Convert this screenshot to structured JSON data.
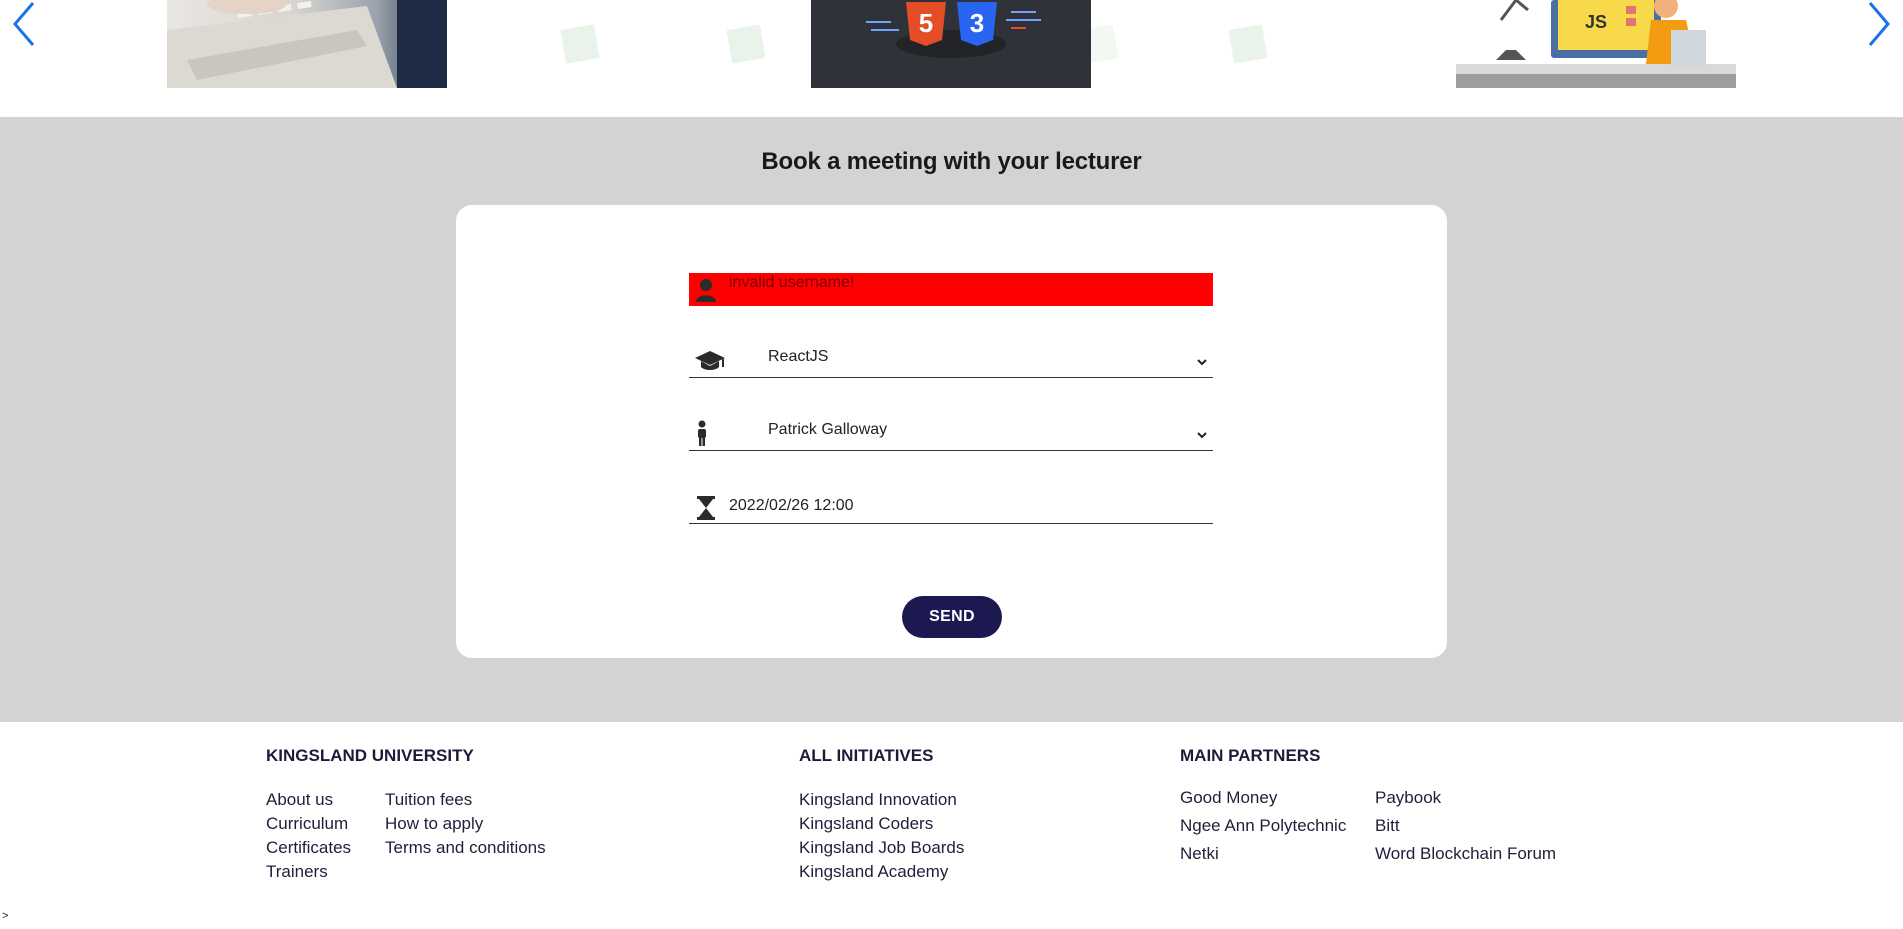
{
  "carousel": {
    "prev_icon": "chevron-left-icon",
    "next_icon": "chevron-right-icon",
    "slides": [
      {
        "name": "laptop-keyboard-photo"
      },
      {
        "name": "html5-css3-logos-image",
        "badge_html": "5",
        "badge_css": "3"
      },
      {
        "name": "javascript-developer-illustration",
        "badge_js": "JS"
      }
    ],
    "accent_color": "#1a73e8"
  },
  "booking": {
    "title": "Book a meeting with your lecturer",
    "username": {
      "value": "invalid username!",
      "icon": "user-icon",
      "error_color": "#ff0000"
    },
    "course": {
      "value": "ReactJS",
      "icon": "graduation-cap-icon"
    },
    "lecturer": {
      "value": "Patrick Galloway",
      "icon": "person-icon"
    },
    "datetime": {
      "value": "2022/02/26 12:00",
      "icon": "hourglass-icon"
    },
    "send_label": "SEND",
    "button_color": "#1c1950"
  },
  "footer": {
    "university": {
      "title": "KINGSLAND UNIVERSITY",
      "col1": [
        "About us",
        "Curriculum",
        "Certificates",
        "Trainers"
      ],
      "col2": [
        "Tuition fees",
        "How to apply",
        "Terms and conditions"
      ]
    },
    "initiatives": {
      "title": "ALL INITIATIVES",
      "items": [
        "Kingsland Innovation",
        "Kingsland Coders",
        "Kingsland Job Boards",
        "Kingsland Academy"
      ]
    },
    "partners": {
      "title": "MAIN PARTNERS",
      "col1": [
        "Good Money",
        "Ngee Ann Polytechnic",
        "Netki"
      ],
      "col2": [
        "Paybook",
        "Bitt",
        "Word Blockchain Forum"
      ]
    },
    "caret": ">"
  }
}
